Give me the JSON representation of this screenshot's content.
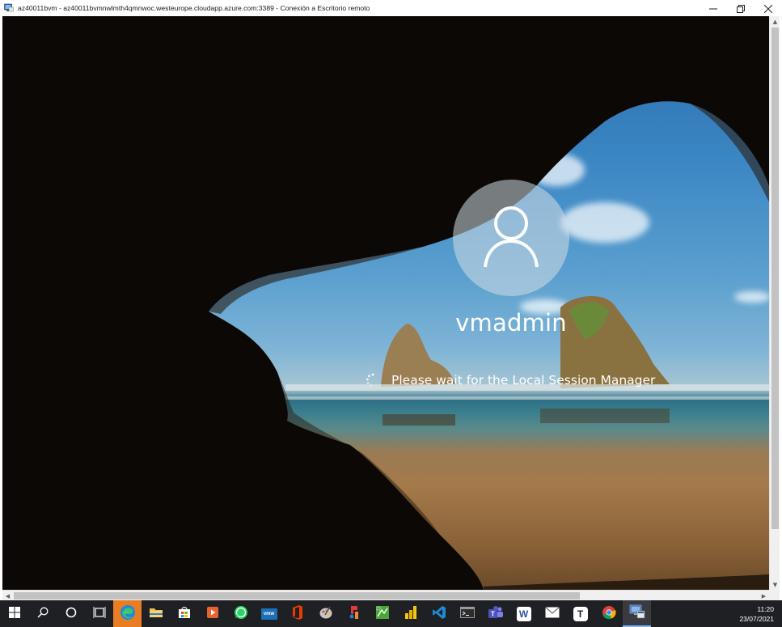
{
  "window": {
    "title": "az40011bvm - az40011bvmnwlmth4qmnwoc.westeurope.cloudapp.azure.com:3389 - Conexión a Escritorio remoto",
    "app_icon": "remote-desktop-icon",
    "controls": {
      "minimize": "minimize-icon",
      "restore": "restore-icon",
      "close": "close-icon"
    }
  },
  "login": {
    "username": "vmadmin",
    "status_text": "Please wait for the Local Session Manager",
    "avatar_icon": "user-avatar-icon",
    "spinner_icon": "loading-spinner-icon"
  },
  "taskbar": {
    "items": [
      {
        "name": "start-button",
        "icon": "windows-logo-icon"
      },
      {
        "name": "search-button",
        "icon": "search-icon"
      },
      {
        "name": "cortana-button",
        "icon": "cortana-circle-icon"
      },
      {
        "name": "task-view-button",
        "icon": "task-view-icon"
      },
      {
        "name": "edge-app",
        "icon": "edge-icon"
      },
      {
        "name": "file-explorer-app",
        "icon": "folder-icon"
      },
      {
        "name": "store-app",
        "icon": "store-bag-icon"
      },
      {
        "name": "media-player-app",
        "icon": "media-player-icon"
      },
      {
        "name": "whatsapp-app",
        "icon": "whatsapp-icon"
      },
      {
        "name": "vmware-app",
        "icon": "vmware-icon",
        "label": "vmw"
      },
      {
        "name": "office-app",
        "icon": "office-icon"
      },
      {
        "name": "app-generic-1",
        "icon": "paint-icon"
      },
      {
        "name": "app-generic-2",
        "icon": "xmind-icon"
      },
      {
        "name": "app-generic-3",
        "icon": "greenshot-icon"
      },
      {
        "name": "powerbi-app",
        "icon": "powerbi-icon"
      },
      {
        "name": "vscode-app",
        "icon": "vscode-icon"
      },
      {
        "name": "terminal-app",
        "icon": "terminal-icon"
      },
      {
        "name": "teams-app",
        "icon": "teams-icon"
      },
      {
        "name": "word-app",
        "icon": "word-icon",
        "label": "W"
      },
      {
        "name": "mail-app",
        "icon": "mail-icon"
      },
      {
        "name": "typora-app",
        "icon": "typora-icon",
        "label": "T"
      },
      {
        "name": "chrome-app",
        "icon": "chrome-icon"
      },
      {
        "name": "remote-desktop-app",
        "icon": "remote-desktop-icon"
      }
    ],
    "clock": {
      "time": "11:20",
      "date": "23/07/2021"
    }
  },
  "colors": {
    "taskbar_bg": "#1f2024",
    "accent": "#7eb4ea",
    "edge_active_bg": "#e87d24"
  }
}
